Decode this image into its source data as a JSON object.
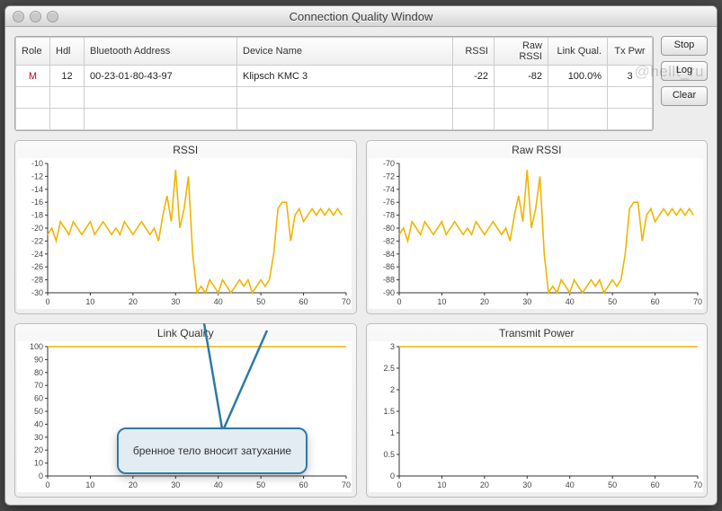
{
  "window": {
    "title": "Connection Quality Window"
  },
  "watermark": "@hellt_ru",
  "buttons": {
    "stop": "Stop",
    "log": "Log",
    "clear": "Clear"
  },
  "table": {
    "headers": [
      "Role",
      "Hdl",
      "Bluetooth Address",
      "Device Name",
      "RSSI",
      "Raw RSSI",
      "Link Qual.",
      "Tx Pwr"
    ],
    "rows": [
      {
        "role": "M",
        "hdl": "12",
        "addr": "00-23-01-80-43-97",
        "name": "Klipsch KMC 3",
        "rssi": "-22",
        "raw_rssi": "-82",
        "link_qual": "100.0%",
        "tx_pwr": "3"
      }
    ]
  },
  "callout": {
    "text": "бренное тело вносит затухание"
  },
  "chart_data": [
    {
      "id": "rssi",
      "type": "line",
      "title": "RSSI",
      "xlabel": "",
      "ylabel": "",
      "xlim": [
        0,
        70
      ],
      "ylim": [
        -30,
        -10
      ],
      "xticks": [
        0,
        10,
        20,
        30,
        40,
        50,
        60,
        70
      ],
      "yticks": [
        -10,
        -12,
        -14,
        -16,
        -18,
        -20,
        -22,
        -24,
        -26,
        -28,
        -30
      ],
      "series": [
        {
          "name": "RSSI",
          "x": [
            0,
            1,
            2,
            3,
            4,
            5,
            6,
            7,
            8,
            9,
            10,
            11,
            12,
            13,
            14,
            15,
            16,
            17,
            18,
            19,
            20,
            21,
            22,
            23,
            24,
            25,
            26,
            27,
            28,
            29,
            30,
            31,
            32,
            33,
            34,
            35,
            36,
            37,
            38,
            39,
            40,
            41,
            42,
            43,
            44,
            45,
            46,
            47,
            48,
            49,
            50,
            51,
            52,
            53,
            54,
            55,
            56,
            57,
            58,
            59,
            60,
            61,
            62,
            63,
            64,
            65,
            66,
            67,
            68,
            69
          ],
          "y": [
            -21,
            -20,
            -22,
            -19,
            -20,
            -21,
            -19,
            -20,
            -21,
            -20,
            -19,
            -21,
            -20,
            -19,
            -20,
            -21,
            -20,
            -21,
            -19,
            -20,
            -21,
            -20,
            -19,
            -20,
            -21,
            -20,
            -22,
            -18,
            -15,
            -19,
            -11,
            -20,
            -17,
            -12,
            -24,
            -30,
            -29,
            -30,
            -28,
            -29,
            -30,
            -28,
            -29,
            -30,
            -29,
            -28,
            -29,
            -28,
            -30,
            -29,
            -28,
            -29,
            -28,
            -24,
            -17,
            -16,
            -16,
            -22,
            -18,
            -17,
            -19,
            -18,
            -17,
            -18,
            -17,
            -18,
            -17,
            -18,
            -17,
            -18
          ]
        }
      ]
    },
    {
      "id": "raw_rssi",
      "type": "line",
      "title": "Raw RSSI",
      "xlim": [
        0,
        70
      ],
      "ylim": [
        -90,
        -70
      ],
      "xticks": [
        0,
        10,
        20,
        30,
        40,
        50,
        60,
        70
      ],
      "yticks": [
        -70,
        -72,
        -74,
        -76,
        -78,
        -80,
        -82,
        -84,
        -86,
        -88,
        -90
      ],
      "series": [
        {
          "name": "Raw RSSI",
          "x": [
            0,
            1,
            2,
            3,
            4,
            5,
            6,
            7,
            8,
            9,
            10,
            11,
            12,
            13,
            14,
            15,
            16,
            17,
            18,
            19,
            20,
            21,
            22,
            23,
            24,
            25,
            26,
            27,
            28,
            29,
            30,
            31,
            32,
            33,
            34,
            35,
            36,
            37,
            38,
            39,
            40,
            41,
            42,
            43,
            44,
            45,
            46,
            47,
            48,
            49,
            50,
            51,
            52,
            53,
            54,
            55,
            56,
            57,
            58,
            59,
            60,
            61,
            62,
            63,
            64,
            65,
            66,
            67,
            68,
            69
          ],
          "y": [
            -81,
            -80,
            -82,
            -79,
            -80,
            -81,
            -79,
            -80,
            -81,
            -80,
            -79,
            -81,
            -80,
            -79,
            -80,
            -81,
            -80,
            -81,
            -79,
            -80,
            -81,
            -80,
            -79,
            -80,
            -81,
            -80,
            -82,
            -78,
            -75,
            -79,
            -71,
            -80,
            -77,
            -72,
            -84,
            -90,
            -89,
            -90,
            -88,
            -89,
            -90,
            -88,
            -89,
            -90,
            -89,
            -88,
            -89,
            -88,
            -90,
            -89,
            -88,
            -89,
            -88,
            -84,
            -77,
            -76,
            -76,
            -82,
            -78,
            -77,
            -79,
            -78,
            -77,
            -78,
            -77,
            -78,
            -77,
            -78,
            -77,
            -78
          ]
        }
      ]
    },
    {
      "id": "link_quality",
      "type": "line",
      "title": "Link Quality",
      "xlim": [
        0,
        70
      ],
      "ylim": [
        0,
        100
      ],
      "xticks": [
        0,
        10,
        20,
        30,
        40,
        50,
        60,
        70
      ],
      "yticks": [
        0,
        10,
        20,
        30,
        40,
        50,
        60,
        70,
        80,
        90,
        100
      ],
      "series": [
        {
          "name": "Link Quality",
          "x": [
            0,
            70
          ],
          "y": [
            100,
            100
          ]
        }
      ]
    },
    {
      "id": "tx_power",
      "type": "line",
      "title": "Transmit Power",
      "xlim": [
        0,
        70
      ],
      "ylim": [
        0,
        3
      ],
      "xticks": [
        0,
        10,
        20,
        30,
        40,
        50,
        60,
        70
      ],
      "yticks": [
        0.0,
        0.5,
        1.0,
        1.5,
        2.0,
        2.5,
        3.0
      ],
      "series": [
        {
          "name": "Tx Power",
          "x": [
            0,
            70
          ],
          "y": [
            3.0,
            3.0
          ]
        }
      ]
    }
  ]
}
